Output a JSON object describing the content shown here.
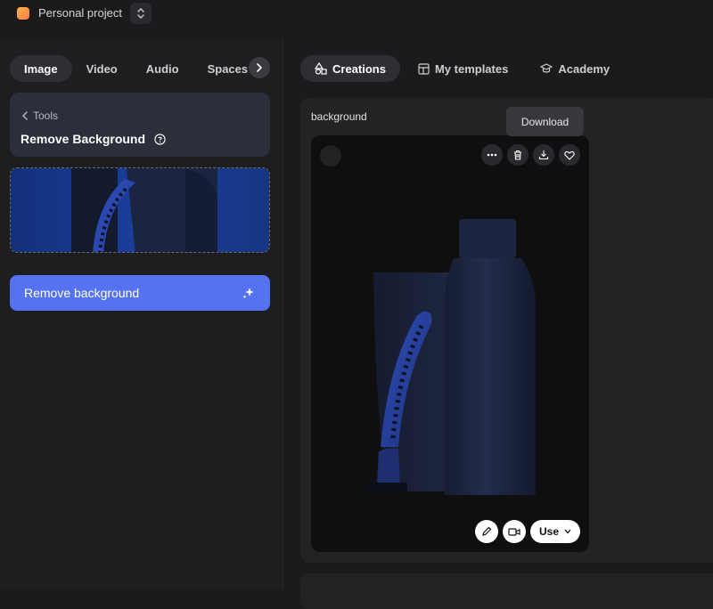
{
  "project": {
    "name": "Personal project"
  },
  "sidebar": {
    "tabs": [
      {
        "label": "Image"
      },
      {
        "label": "Video"
      },
      {
        "label": "Audio"
      },
      {
        "label": "Spaces"
      }
    ],
    "breadcrumb": "Tools",
    "tool_title": "Remove Background",
    "cta_label": "Remove background"
  },
  "main": {
    "tabs": [
      {
        "label": "Creations"
      },
      {
        "label": "My templates"
      },
      {
        "label": "Academy"
      }
    ],
    "panel_label": "background",
    "tooltip": "Download",
    "use_label": "Use"
  },
  "colors": {
    "accent": "#5573f0",
    "bg": "#1b1b1d",
    "card": "#0f0f10"
  }
}
